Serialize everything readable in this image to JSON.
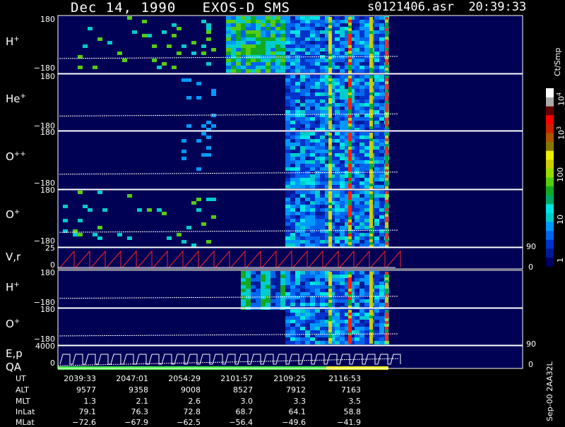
{
  "header": {
    "date": "Dec 14, 1990",
    "instrument": "EXOS-D SMS",
    "filename": "s0121406.asr",
    "time": "20:39:33"
  },
  "colorbar": {
    "unit": "Ct/Smp",
    "tick_labels": [
      "1",
      "10",
      "100",
      "10",
      "10"
    ],
    "tick_exponents": [
      "",
      "",
      "",
      "3",
      "4"
    ],
    "colors": [
      "#000066",
      "#001a99",
      "#0033cc",
      "#0066ee",
      "#0099ff",
      "#00cccc",
      "#00e5e5",
      "#00aa66",
      "#11aa22",
      "#55cc11",
      "#99dd00",
      "#cccc00",
      "#eeee00",
      "#887700",
      "#aa5500",
      "#cc2200",
      "#ff0000",
      "#660000",
      "#aaaaaa",
      "#ffffff"
    ]
  },
  "footer": {
    "vertical_label": "Sep-00  2AA32L"
  },
  "chart_data": {
    "type": "heatmap",
    "title": "Dec 14, 1990   EXOS-D SMS",
    "panels": [
      {
        "name": "H",
        "superscript": "+",
        "ylim": [
          -180,
          180
        ],
        "ytick_labels": [
          "180",
          "−180"
        ]
      },
      {
        "name": "He",
        "superscript": "+",
        "ylim": [
          -180,
          180
        ],
        "ytick_labels": [
          "180",
          "−180"
        ]
      },
      {
        "name": "O",
        "superscript": "++",
        "ylim": [
          -180,
          180
        ],
        "ytick_labels": [
          "180",
          "−180"
        ]
      },
      {
        "name": "O",
        "superscript": "+",
        "ylim": [
          -180,
          180
        ],
        "ytick_labels": [
          "180",
          "−180"
        ]
      },
      {
        "name": "V,r",
        "superscript": "",
        "ylim": [
          0,
          25
        ],
        "ytick_labels": [
          "25",
          "0"
        ],
        "right_ticks": [
          "90",
          "0"
        ]
      },
      {
        "name": "H",
        "superscript": "+",
        "ylim": [
          -180,
          180
        ],
        "ytick_labels": [
          "180",
          "−180"
        ]
      },
      {
        "name": "O",
        "superscript": "+",
        "ylim": [
          -180,
          180
        ],
        "ytick_labels": [
          "180",
          "−180"
        ]
      },
      {
        "name": "E,p",
        "second_name": "QA",
        "superscript": "",
        "ylim": [
          0,
          4000
        ],
        "ytick_labels": [
          "4000",
          "0"
        ],
        "right_ticks": [
          "90",
          "0"
        ]
      }
    ],
    "table": {
      "rows": [
        {
          "label": "UT",
          "values": [
            "2039:33",
            "2047:01",
            "2054:29",
            "2101:57",
            "2109:25",
            "2116:53"
          ]
        },
        {
          "label": "ALT",
          "values": [
            "9577",
            "9358",
            "9008",
            "8527",
            "7912",
            "7163"
          ]
        },
        {
          "label": "MLT",
          "values": [
            "1.3",
            "2.1",
            "2.6",
            "3.0",
            "3.3",
            "3.5"
          ]
        },
        {
          "label": "InLat",
          "values": [
            "79.1",
            "76.3",
            "72.8",
            "68.7",
            "64.1",
            "58.8"
          ]
        },
        {
          "label": "MLat",
          "values": [
            "−72.6",
            "−67.9",
            "−62.5",
            "−56.4",
            "−49.6",
            "−41.9"
          ]
        }
      ]
    }
  }
}
